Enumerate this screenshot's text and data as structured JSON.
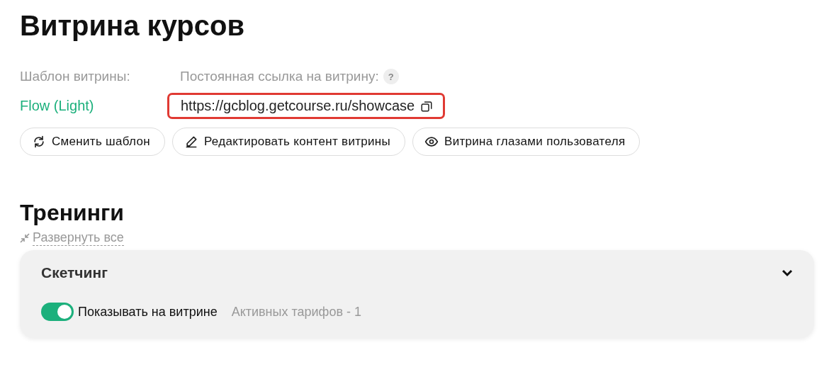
{
  "title": "Витрина курсов",
  "template": {
    "label": "Шаблон витрины:",
    "value": "Flow (Light)"
  },
  "permalink": {
    "label": "Постоянная ссылка на витрину:",
    "help": "?",
    "url": "https://gcblog.getcourse.ru/showcase"
  },
  "buttons": [
    {
      "kind": "switch",
      "label": "Сменить шаблон"
    },
    {
      "kind": "edit",
      "label": "Редактировать контент витрины"
    },
    {
      "kind": "preview",
      "label": "Витрина глазами пользователя"
    }
  ],
  "section": {
    "title": "Тренинги",
    "expand_all": "Развернуть все"
  },
  "trainings": [
    {
      "name": "Скетчинг",
      "expanded": false,
      "toggle": {
        "label": "Показывать на витрине",
        "on": true
      },
      "tariffs": "Активных тарифов - 1"
    }
  ]
}
